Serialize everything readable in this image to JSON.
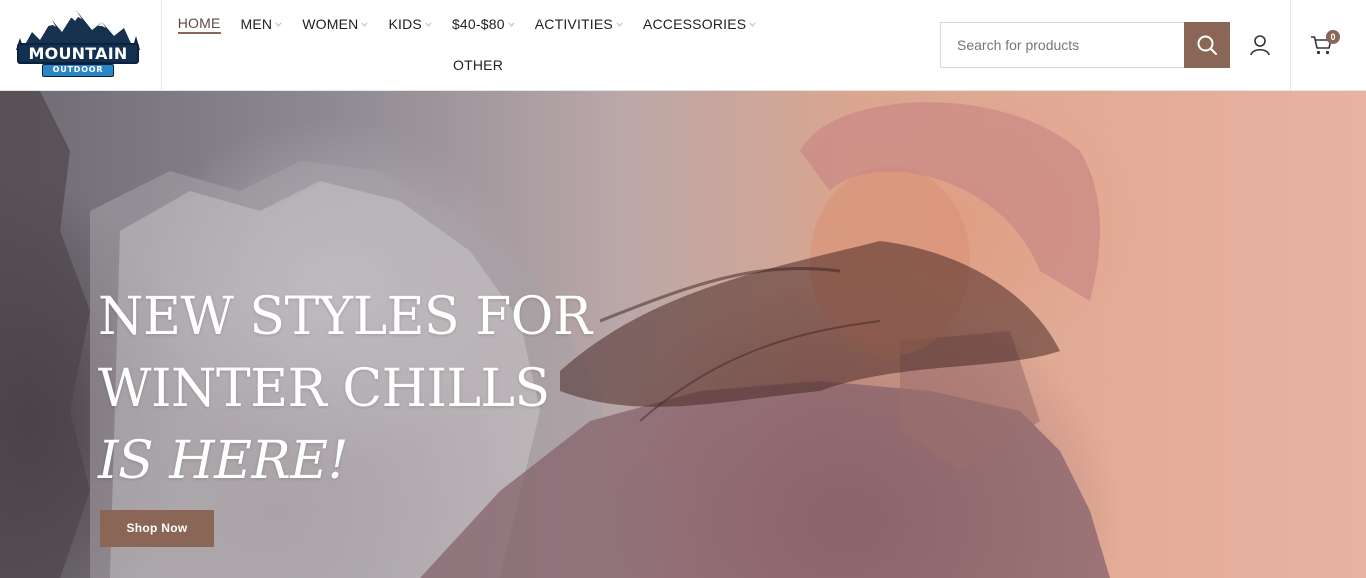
{
  "logo": {
    "name": "MOUNTAIN",
    "tagline": "OUTDOOR"
  },
  "nav": {
    "row1": [
      {
        "label": "HOME",
        "active": true,
        "has_dropdown": false
      },
      {
        "label": "MEN",
        "active": false,
        "has_dropdown": true
      },
      {
        "label": "WOMEN",
        "active": false,
        "has_dropdown": true
      },
      {
        "label": "KIDS",
        "active": false,
        "has_dropdown": true
      },
      {
        "label": "$40-$80",
        "active": false,
        "has_dropdown": true
      },
      {
        "label": "ACTIVITIES",
        "active": false,
        "has_dropdown": true
      },
      {
        "label": "ACCESSORIES",
        "active": false,
        "has_dropdown": true
      }
    ],
    "row2": [
      {
        "label": "OTHER",
        "active": false,
        "has_dropdown": false
      }
    ]
  },
  "search": {
    "placeholder": "Search for products",
    "value": "",
    "icon": "search-icon"
  },
  "account": {
    "icon": "user-icon"
  },
  "cart": {
    "icon": "cart-icon",
    "count": "0"
  },
  "hero": {
    "line1": "NEW STYLES FOR",
    "line2": "WINTER CHILLS",
    "line3": "IS HERE!",
    "button_label": "Shop Now"
  },
  "colors": {
    "accent": "#8a6656",
    "nav_text": "#1f1f1f",
    "hero_text": "#ffffff"
  }
}
